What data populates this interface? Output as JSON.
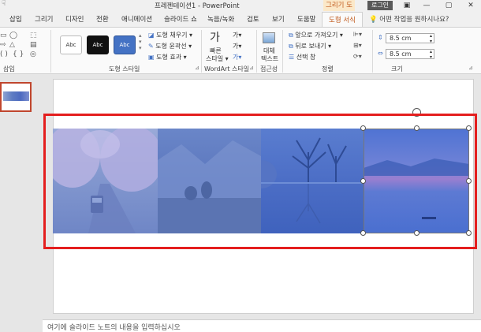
{
  "window": {
    "qat_icon": "touch-mode-icon",
    "title": "프레젠테이션1 - PowerPoint",
    "tool_tab": "그리기 도구",
    "login": "로그인",
    "minimize": "—",
    "restore": "▢",
    "close": "✕"
  },
  "tabs": [
    "삽입",
    "그리기",
    "디자인",
    "전환",
    "애니메이션",
    "슬라이드 쇼",
    "녹음/녹화",
    "검토",
    "보기",
    "도움말"
  ],
  "active_tab": "도형 서식",
  "tell_me": "어떤 작업을 원하시나요?",
  "ribbon": {
    "insert_group": "삽입",
    "style_samples": [
      "Abc",
      "Abc",
      "Abc"
    ],
    "shape_fill": "도형 채우기 ▾",
    "shape_outline": "도형 윤곽선 ▾",
    "shape_effects": "도형 효과 ▾",
    "shape_styles_group": "도형 스타일",
    "quick_styles_line1": "빠른",
    "quick_styles_line2": "스타일 ▾",
    "wordart_group": "WordArt 스타일",
    "alt_text_line1": "대체",
    "alt_text_line2": "텍스트",
    "accessibility_group": "접근성",
    "bring_forward": "앞으로 가져오기 ▾",
    "send_backward": "뒤로 보내기 ▾",
    "selection_pane": "선택 창",
    "arrange_group": "정렬",
    "height": "8.5 cm",
    "width": "8.5 cm",
    "size_group": "크기"
  },
  "notes_placeholder": "여기에 슬라이드 노트의 내용을 입력하십시오",
  "colors": {
    "accent": "#c0581a",
    "highlight_frame": "#e41e1e",
    "photo_tint": "#5470c0"
  }
}
